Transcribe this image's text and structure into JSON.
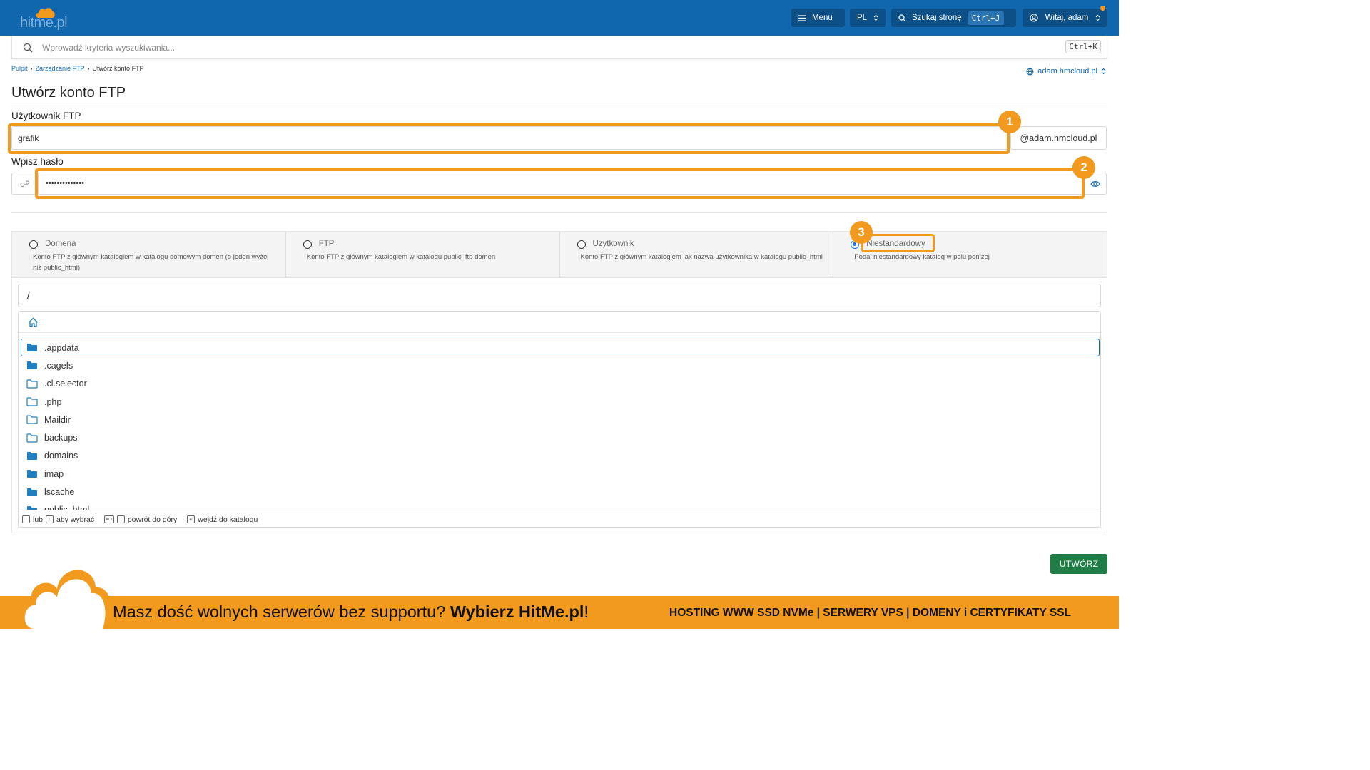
{
  "header": {
    "logo_text": "hitme.pl",
    "menu_label": "Menu",
    "lang_label": "PL",
    "search_page_label": "Szukaj stronę",
    "search_page_shortcut": "Ctrl+J",
    "user_label": "Witaj, adam"
  },
  "search": {
    "placeholder": "Wprowadź kryteria wyszukiwania...",
    "shortcut": "Ctrl+K"
  },
  "breadcrumb": [
    "Pulpit",
    "Zarządzanie FTP",
    "Utwórz konto FTP"
  ],
  "domain_selector": "adam.hmcloud.pl",
  "page_title": "Utwórz konto FTP",
  "form": {
    "user_label": "Użytkownik FTP",
    "user_value": "grafik",
    "user_suffix": "@adam.hmcloud.pl",
    "password_label": "Wpisz hasło",
    "password_value": "••••••••••••••"
  },
  "annotations": [
    "1",
    "2",
    "3"
  ],
  "options": [
    {
      "title": "Domena",
      "desc": "Konto FTP z głównym katalogiem w katalogu domowym domen (o jeden wyżej niż public_html)",
      "checked": false
    },
    {
      "title": "FTP",
      "desc": "Konto FTP z głównym katalogiem w katalogu public_ftp domen",
      "checked": false
    },
    {
      "title": "Użytkownik",
      "desc": "Konto FTP z głównym katalogiem jak nazwa użytkownika w katalogu public_html",
      "checked": false
    },
    {
      "title": "Niestandardowy",
      "desc": "Podaj niestandardowy katalog w polu poniżej",
      "checked": true
    }
  ],
  "path_value": "/",
  "files": [
    {
      "name": ".appdata",
      "filled": true,
      "selected": true
    },
    {
      "name": ".cagefs",
      "filled": true,
      "selected": false
    },
    {
      "name": ".cl.selector",
      "filled": false,
      "selected": false
    },
    {
      "name": ".php",
      "filled": false,
      "selected": false
    },
    {
      "name": "Maildir",
      "filled": false,
      "selected": false
    },
    {
      "name": "backups",
      "filled": false,
      "selected": false
    },
    {
      "name": "domains",
      "filled": true,
      "selected": false
    },
    {
      "name": "imap",
      "filled": true,
      "selected": false
    },
    {
      "name": "lscache",
      "filled": true,
      "selected": false
    },
    {
      "name": "public_html",
      "filled": true,
      "selected": false
    }
  ],
  "footer_hints": {
    "or": "lub",
    "select": "aby wybrać",
    "alt_key": "ALT",
    "go_up": "powrót do góry",
    "enter_dir": "wejdź do katalogu"
  },
  "create_button": "UTWÓRZ",
  "banner": {
    "text_plain": "Masz dość wolnych serwerów bez supportu? ",
    "text_bold": "Wybierz HitMe.pl",
    "text_end": "!",
    "right_text": "HOSTING WWW SSD NVMe | SERWERY VPS | DOMENY i CERTYFIKATY SSL"
  },
  "colors": {
    "topbar": "#1167ad",
    "accent_orange": "#f29a1e",
    "create_green": "#1f7d45",
    "folder_blue": "#1f7fc0"
  }
}
